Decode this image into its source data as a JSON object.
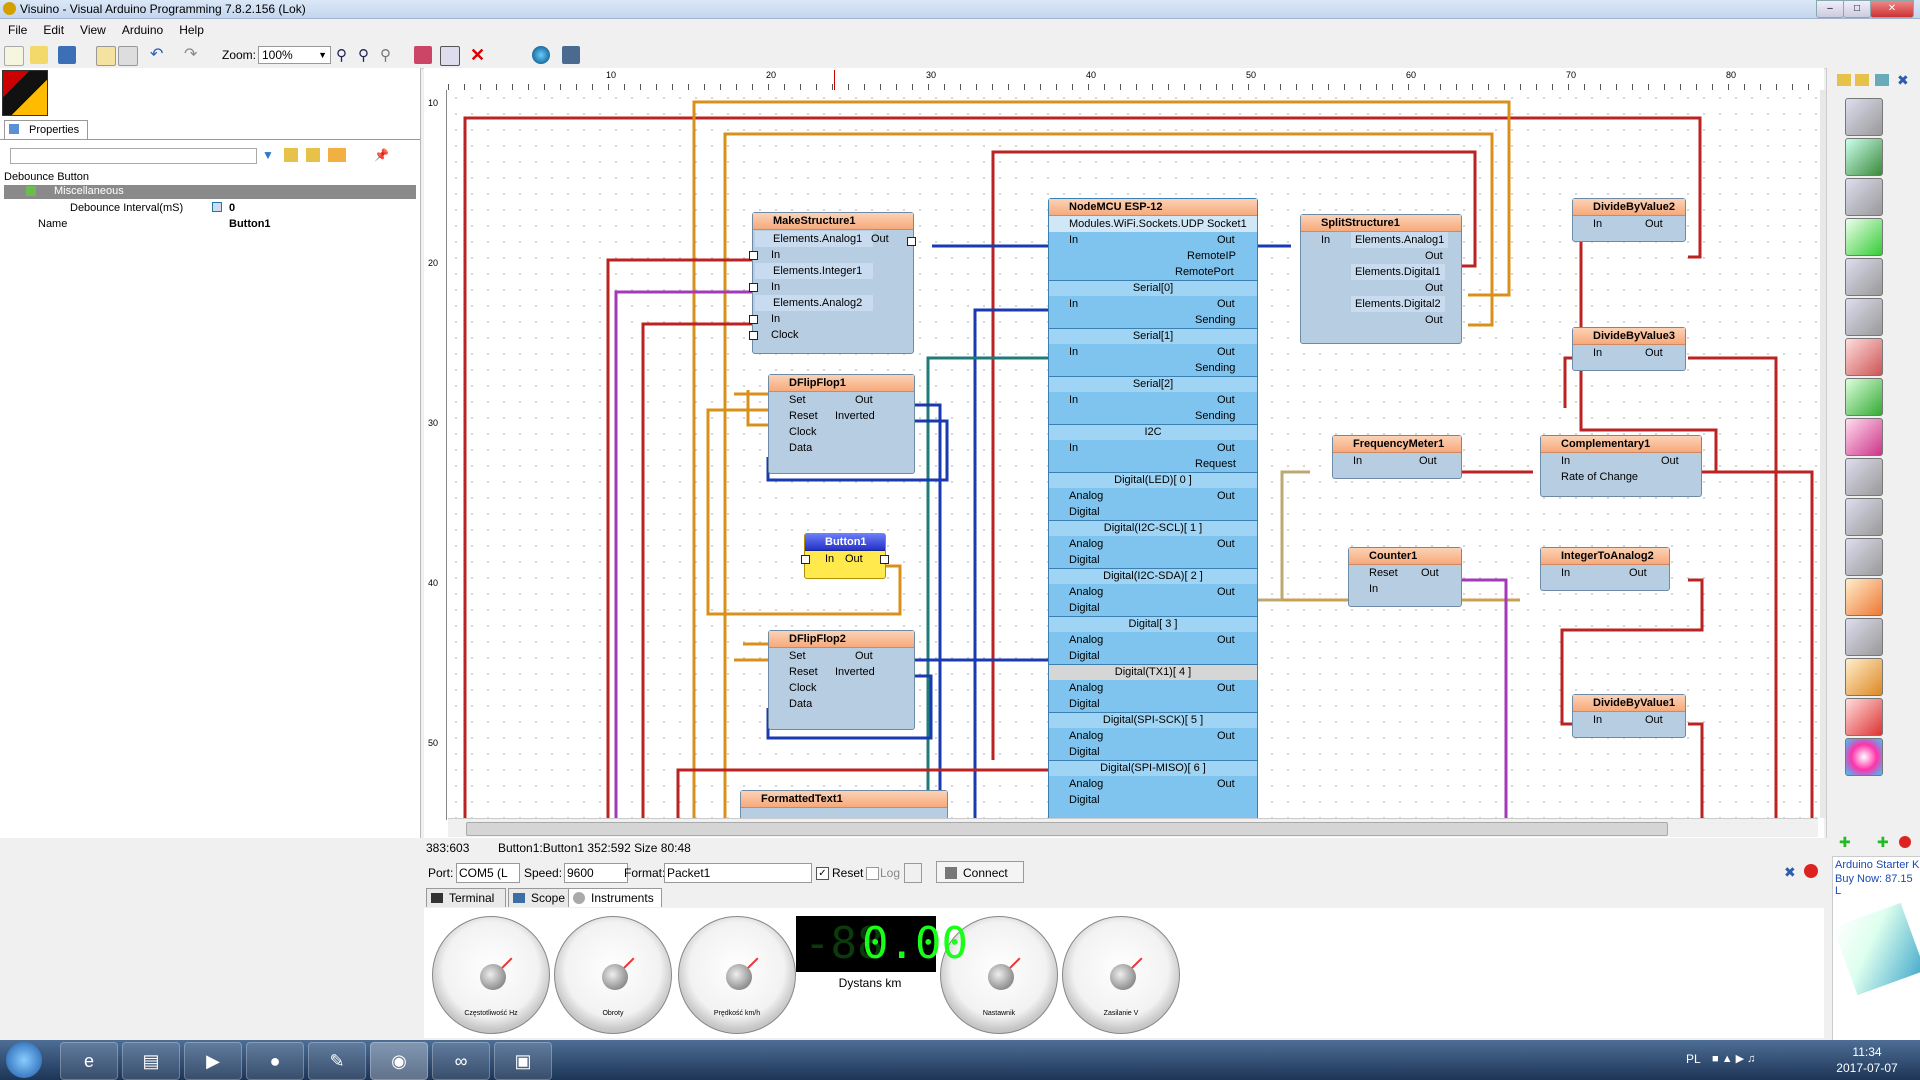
{
  "window": {
    "title": "Visuino - Visual Arduino Programming 7.8.2.156 (Lok)"
  },
  "menu": [
    "File",
    "Edit",
    "View",
    "Arduino",
    "Help"
  ],
  "toolbar": {
    "zoom_label": "Zoom:",
    "zoom_value": "100%"
  },
  "properties": {
    "tab_label": "Properties",
    "object_name": "Debounce Button",
    "category": "Miscellaneous",
    "rows": [
      {
        "name": "Debounce Interval(mS)",
        "value": "0"
      },
      {
        "name": "Name",
        "value": "Button1"
      }
    ]
  },
  "ruler": {
    "h_ticks": [
      "10",
      "20",
      "30",
      "40",
      "50",
      "60",
      "70",
      "80"
    ],
    "v_ticks": [
      "10",
      "20",
      "30",
      "40",
      "50"
    ]
  },
  "components": {
    "make_structure": {
      "title": "MakeStructure1",
      "rows": [
        "Elements.Analog1",
        "In",
        "Elements.Integer1",
        "In",
        "Elements.Analog2",
        "In",
        "Clock"
      ],
      "out": "Out"
    },
    "dflipflop1": {
      "title": "DFlipFlop1",
      "rows": [
        "Set",
        "Reset",
        "Clock",
        "Data"
      ],
      "outs": [
        "Out",
        "Inverted"
      ]
    },
    "button1": {
      "title": "Button1",
      "in": "In",
      "out": "Out"
    },
    "dflipflop2": {
      "title": "DFlipFlop2",
      "rows": [
        "Set",
        "Reset",
        "Clock",
        "Data"
      ],
      "outs": [
        "Out",
        "Inverted"
      ]
    },
    "formatted_text": {
      "title": "FormattedText1"
    },
    "nodemcu": {
      "title": "NodeMCU ESP-12",
      "socket": "Modules.WiFi.Sockets.UDP Socket1",
      "socket_rows": [
        "In",
        "Out",
        "RemoteIP",
        "RemotePort"
      ],
      "sections": [
        "Serial[0]",
        "Serial[1]",
        "Serial[2]",
        "I2C",
        "Digital(LED)[ 0 ]",
        "Digital(I2C-SCL)[ 1 ]",
        "Digital(I2C-SDA)[ 2 ]",
        "Digital[ 3 ]",
        "Digital(TX1)[ 4 ]",
        "Digital(SPI-SCK)[ 5 ]",
        "Digital(SPI-MISO)[ 6 ]"
      ],
      "pin_labels": {
        "in": "In",
        "out": "Out",
        "sending": "Sending",
        "request": "Request",
        "analog": "Analog",
        "digital": "Digital"
      }
    },
    "split_structure": {
      "title": "SplitStructure1",
      "rows": [
        "In",
        "Elements.Analog1",
        "Out",
        "Elements.Digital1",
        "Out",
        "Elements.Digital2",
        "Out"
      ]
    },
    "divide2": {
      "title": "DivideByValue2",
      "in": "In",
      "out": "Out"
    },
    "divide3": {
      "title": "DivideByValue3",
      "in": "In",
      "out": "Out"
    },
    "frequency": {
      "title": "FrequencyMeter1",
      "in": "In",
      "out": "Out"
    },
    "complementary": {
      "title": "Complementary1",
      "rows": [
        "In",
        "Rate of Change"
      ],
      "out": "Out"
    },
    "counter": {
      "title": "Counter1",
      "rows": [
        "Reset",
        "In"
      ],
      "out": "Out"
    },
    "int2analog": {
      "title": "IntegerToAnalog2",
      "in": "In",
      "out": "Out"
    },
    "divide1": {
      "title": "DivideByValue1",
      "in": "In",
      "out": "Out"
    }
  },
  "status": {
    "coords": "383:603",
    "info": "Button1:Button1 352:592 Size 80:48"
  },
  "connection": {
    "port_label": "Port:",
    "port_value": "COM5 (L",
    "speed_label": "Speed:",
    "speed_value": "9600",
    "format_label": "Format:",
    "format_value": "Packet1",
    "reset_label": "Reset",
    "log_label": "Log",
    "connect_label": "Connect"
  },
  "bottom_tabs": [
    "Terminal",
    "Scope",
    "Instruments"
  ],
  "instruments": {
    "gauges": [
      "Częstotliwość Hz",
      "Obroty",
      "Prędkość km/h",
      "Nastawnik",
      "Zasilanie V"
    ],
    "lcd_value": "0.00",
    "lcd_ghost": "-88",
    "lcd_caption": "Dystans km"
  },
  "ad": {
    "line1": "Arduino Starter K",
    "line2": "Buy Now: 87.15 L"
  },
  "taskbar": {
    "lang": "PL",
    "time": "11:34",
    "date": "2017-07-07"
  }
}
